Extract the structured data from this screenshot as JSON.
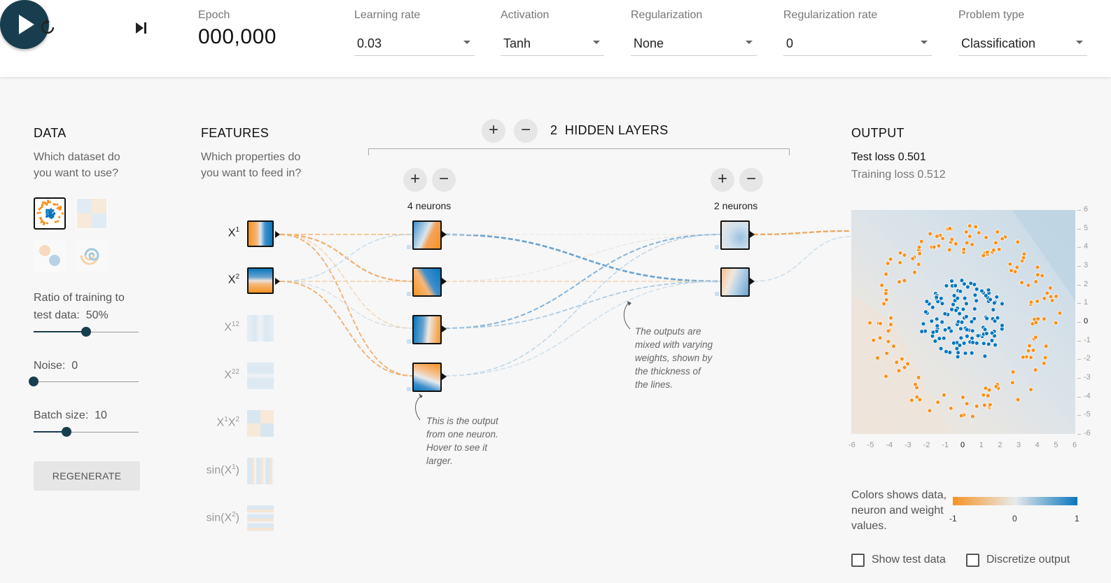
{
  "controls": {
    "reset_icon": "reset-icon",
    "play_icon": "play-icon",
    "step_icon": "step-icon"
  },
  "epoch": {
    "label": "Epoch",
    "value": "000,000"
  },
  "settings": {
    "learning_rate": {
      "label": "Learning rate",
      "value": "0.03"
    },
    "activation": {
      "label": "Activation",
      "value": "Tanh"
    },
    "regularization": {
      "label": "Regularization",
      "value": "None"
    },
    "regularization_rate": {
      "label": "Regularization rate",
      "value": "0"
    },
    "problem_type": {
      "label": "Problem type",
      "value": "Classification"
    }
  },
  "data": {
    "title": "DATA",
    "desc": "Which dataset do you want to use?",
    "ratio_label": "Ratio of training to",
    "ratio_label2": "test data:",
    "ratio_value": "50%",
    "ratio_fraction": 0.5,
    "noise_label": "Noise:",
    "noise_value": "0",
    "noise_fraction": 0,
    "batch_label": "Batch size:",
    "batch_value": "10",
    "batch_fraction": 0.31,
    "regenerate": "REGENERATE"
  },
  "features": {
    "title": "FEATURES",
    "desc": "Which properties do you want to feed in?",
    "items": [
      {
        "base": "X",
        "sup": "1",
        "active": true
      },
      {
        "base": "X",
        "sup": "2",
        "active": true
      },
      {
        "base": "X",
        "sup": "12",
        "active": false
      },
      {
        "base": "X",
        "sup": "22",
        "active": false
      },
      {
        "base": "X",
        "sup": "1",
        "base2": "X",
        "sup2": "2",
        "active": false
      },
      {
        "base": "sin(X",
        "sup": "1",
        "tail": ")",
        "active": false
      },
      {
        "base": "sin(X",
        "sup": "2",
        "tail": ")",
        "active": false
      }
    ]
  },
  "network": {
    "hidden_count": "2",
    "hidden_label": "HIDDEN LAYERS",
    "add_layer": "+",
    "remove_layer": "−",
    "layers": [
      {
        "neurons_label": "4 neurons",
        "add": "+",
        "remove": "−"
      },
      {
        "neurons_label": "2 neurons",
        "add": "+",
        "remove": "−"
      }
    ]
  },
  "annotations": {
    "neuron_note": [
      "This is the output",
      "from one neuron.",
      "Hover to see it",
      "larger."
    ],
    "weights_note": [
      "The outputs are",
      "mixed with varying",
      "weights, shown by",
      "the thickness of",
      "the lines."
    ]
  },
  "output": {
    "title": "OUTPUT",
    "test_loss": "Test loss 0.501",
    "train_loss": "Training loss 0.512",
    "x_ticks": [
      "-6",
      "-5",
      "-4",
      "-3",
      "-2",
      "-1",
      "0",
      "1",
      "2",
      "3",
      "4",
      "5",
      "6"
    ],
    "y_ticks": [
      "6",
      "5",
      "4",
      "3",
      "2",
      "1",
      "0",
      "-1",
      "-2",
      "-3",
      "-4",
      "-5",
      "-6"
    ]
  },
  "legend": {
    "text": "Colors shows data, neuron and weight values.",
    "min": "-1",
    "mid": "0",
    "max": "1"
  },
  "checkboxes": {
    "show_test": "Show test data",
    "discretize": "Discretize output"
  },
  "colors": {
    "orange": "#f59322",
    "blue": "#0877bd",
    "dark": "#183d4e"
  }
}
